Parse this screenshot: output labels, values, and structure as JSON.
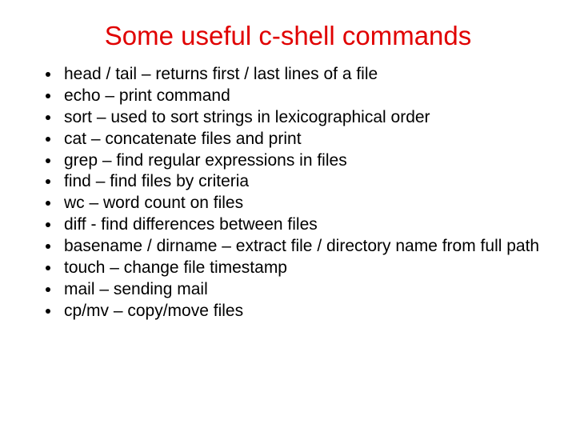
{
  "title": "Some useful c-shell commands",
  "items": [
    "head / tail – returns first / last lines of a file",
    "echo – print command",
    "sort – used to sort strings in lexicographical order",
    "cat – concatenate files and print",
    "grep – find regular expressions in files",
    "find – find files by criteria",
    "wc – word count on files",
    "diff -  find differences between files",
    "basename / dirname – extract file / directory name from full path",
    "touch – change file timestamp",
    "mail – sending mail",
    "cp/mv – copy/move files"
  ]
}
